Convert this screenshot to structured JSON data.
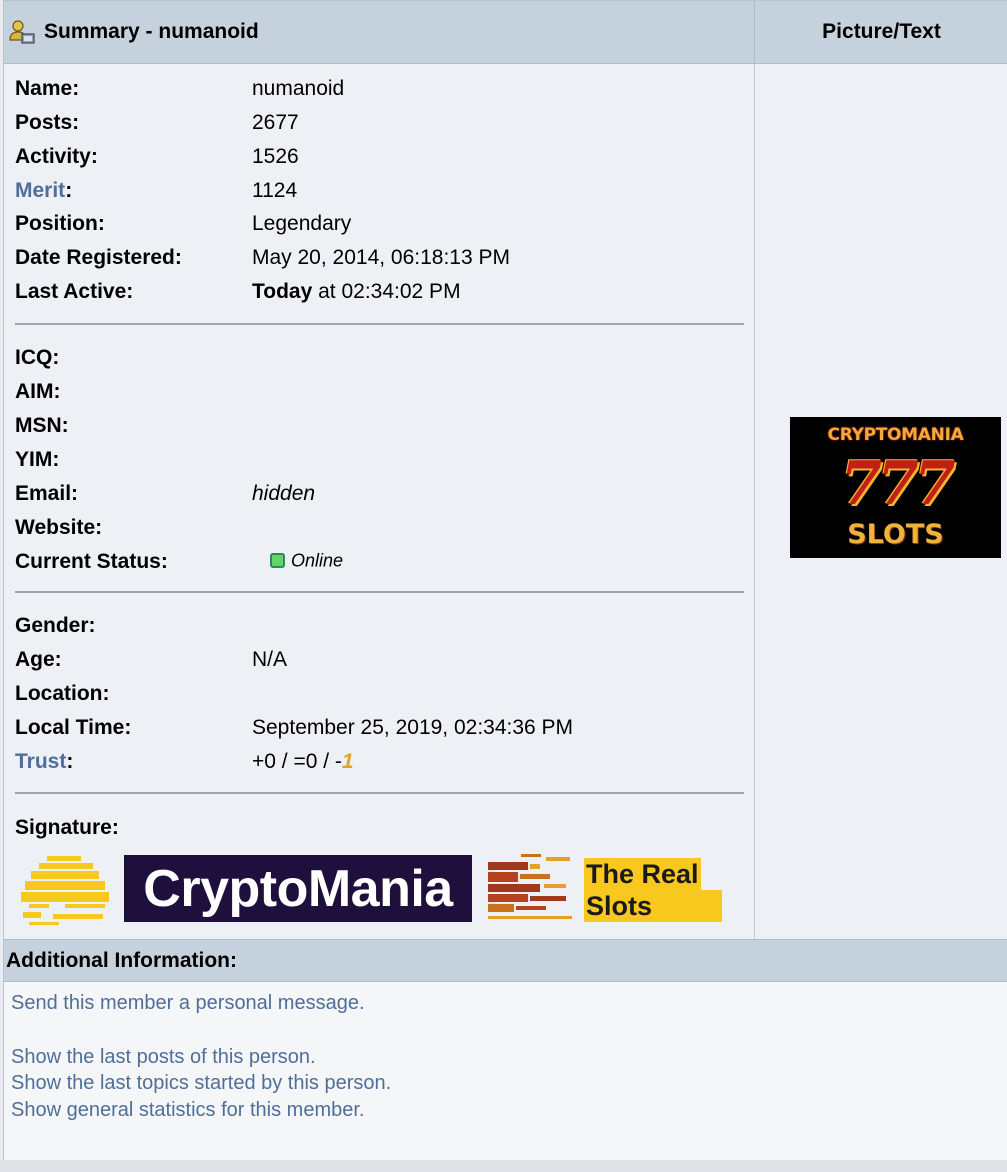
{
  "header": {
    "title": "Summary - numanoid",
    "picture_col_title": "Picture/Text"
  },
  "profile": {
    "name_label": "Name:",
    "name_value": "numanoid",
    "posts_label": "Posts:",
    "posts_value": "2677",
    "activity_label": "Activity:",
    "activity_value": "1526",
    "merit_label": "Merit",
    "merit_colon": ":",
    "merit_value": "1124",
    "position_label": "Position:",
    "position_value": "Legendary",
    "registered_label": "Date Registered:",
    "registered_value": "May 20, 2014, 06:18:13 PM",
    "last_active_label": "Last Active:",
    "last_active_today": "Today",
    "last_active_rest": " at 02:34:02 PM"
  },
  "contact": {
    "icq_label": "ICQ:",
    "aim_label": "AIM:",
    "msn_label": "MSN:",
    "yim_label": "YIM:",
    "email_label": "Email:",
    "email_value": "hidden",
    "website_label": "Website:",
    "status_label": "Current Status:",
    "status_value": "Online"
  },
  "personal": {
    "gender_label": "Gender:",
    "age_label": "Age:",
    "age_value": "N/A",
    "location_label": "Location:",
    "local_time_label": "Local Time:",
    "local_time_value": "September 25, 2019, 02:34:36 PM",
    "trust_label": "Trust",
    "trust_colon": ":",
    "trust_prefix": "+0 / =0 / -",
    "trust_negative": "1"
  },
  "signature": {
    "label": "Signature:",
    "banner_text": "CryptoMania",
    "tagline_line1": "The Real",
    "tagline_line2": "Slots"
  },
  "avatar": {
    "line1": "CRYPTOMANIA",
    "line2": "777",
    "line3": "SLOTS"
  },
  "additional": {
    "title": "Additional Information:",
    "links": [
      "Send this member a personal message.",
      "Show the last posts of this person.",
      "Show the last topics started by this person.",
      "Show general statistics for this member."
    ]
  },
  "colors": {
    "header_bg": "#c5d1dc",
    "link": "#4f6e9a",
    "online": "#64d36d",
    "trust_negative": "#e0a520",
    "banner_bg": "#1e0f3d",
    "tagline_bg": "#f8c81e"
  }
}
